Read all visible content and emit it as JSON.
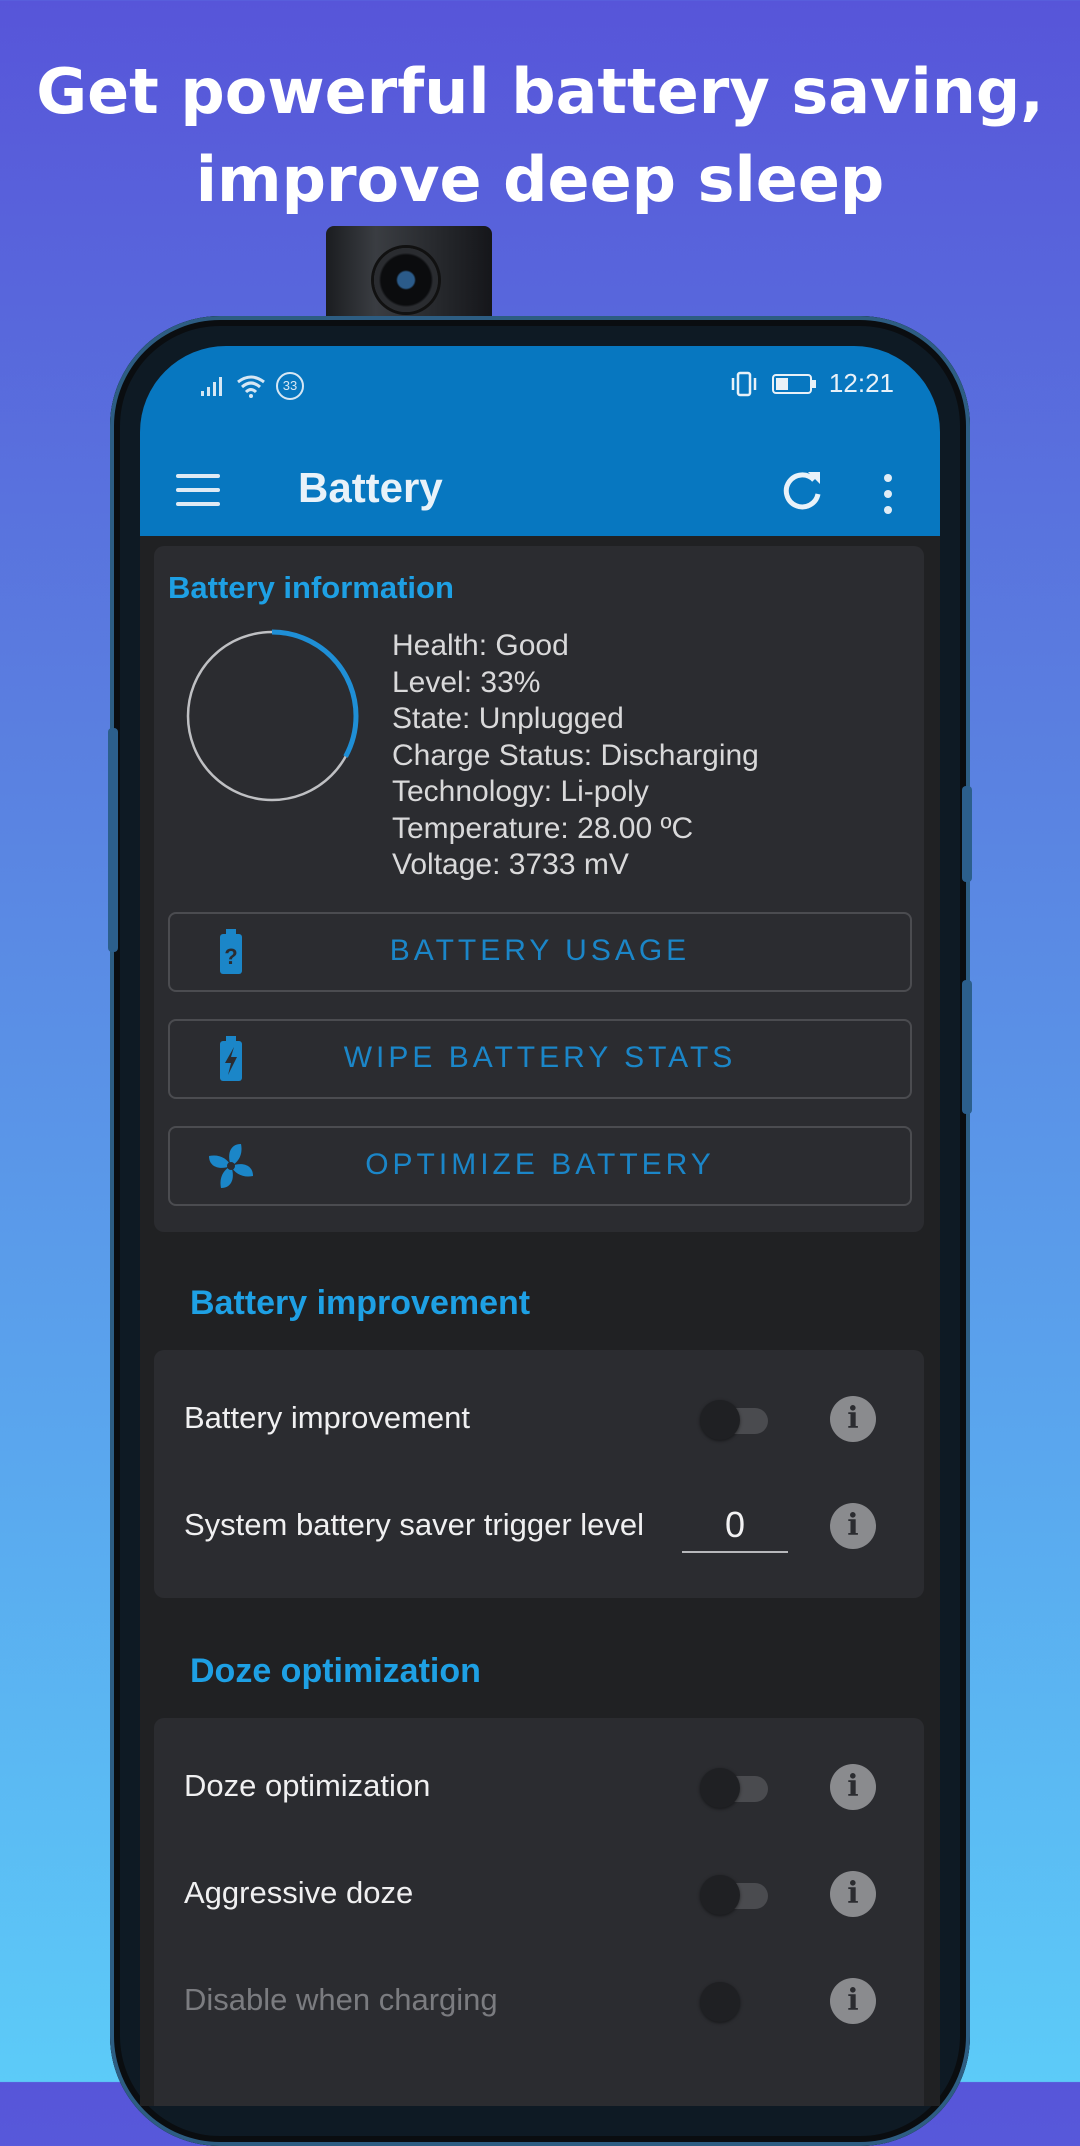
{
  "promo": {
    "line1": "Get powerful battery saving,",
    "line2": "improve deep sleep"
  },
  "status_bar": {
    "left_icons": [
      "signal-icon",
      "wifi-icon",
      "data-badge-icon"
    ],
    "data_badge": "33",
    "right_icons": [
      "vibrate-icon",
      "battery-icon"
    ],
    "time": "12:21"
  },
  "app_bar": {
    "title": "Battery",
    "menu_icon": "hamburger-icon",
    "refresh_icon": "refresh-icon",
    "more_icon": "more-vert-icon",
    "color": "#0777c0"
  },
  "battery_info": {
    "title": "Battery information",
    "level_fraction": 0.33,
    "details": [
      "Health: Good",
      "Level: 33%",
      "State: Unplugged",
      "Charge Status: Discharging",
      "Technology: Li-poly",
      "Temperature: 28.00 ºC",
      "Voltage: 3733 mV"
    ],
    "buttons": [
      {
        "label": "BATTERY USAGE",
        "icon": "battery-question-icon"
      },
      {
        "label": "WIPE BATTERY STATS",
        "icon": "battery-bolt-icon"
      },
      {
        "label": "OPTIMIZE BATTERY",
        "icon": "fan-icon"
      }
    ]
  },
  "battery_improvement": {
    "section_title": "Battery improvement",
    "rows": [
      {
        "label": "Battery improvement",
        "type": "toggle",
        "on": false
      },
      {
        "label": "System battery saver trigger level",
        "type": "number",
        "value": "0"
      }
    ]
  },
  "doze_optimization": {
    "section_title": "Doze optimization",
    "rows": [
      {
        "label": "Doze optimization",
        "type": "toggle",
        "on": false,
        "disabled": false
      },
      {
        "label": "Aggressive doze",
        "type": "toggle",
        "on": false,
        "disabled": false
      },
      {
        "label": "Disable when charging",
        "type": "toggle",
        "on": false,
        "disabled": true
      }
    ]
  },
  "colors": {
    "accent": "#1ea0e4",
    "button_text": "#1b86c8",
    "card": "#2b2c30",
    "background": "#202123"
  }
}
